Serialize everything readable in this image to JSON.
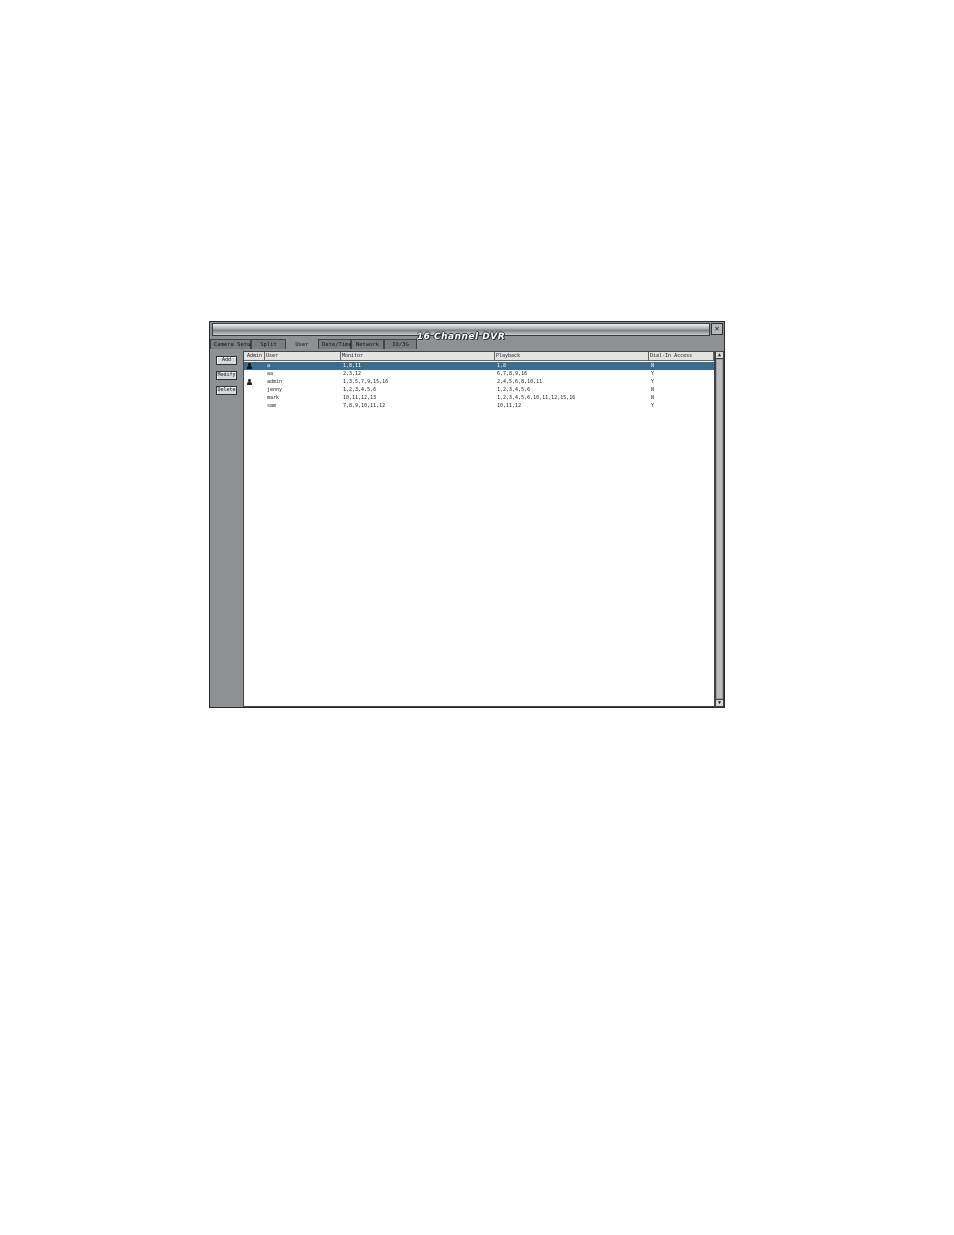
{
  "window": {
    "title": "16 Channel DVR",
    "close_icon": "close-icon"
  },
  "tabs": [
    {
      "label": "Camera Setup",
      "active": false
    },
    {
      "label": "Split",
      "active": false
    },
    {
      "label": "User",
      "active": true
    },
    {
      "label": "Date/Time",
      "active": false
    },
    {
      "label": "Network",
      "active": false
    },
    {
      "label": "IO/3G",
      "active": false
    }
  ],
  "actions": {
    "add_label": "Add",
    "modify_label": "Modify",
    "delete_label": "Delete"
  },
  "table": {
    "columns": [
      "Admin",
      "User",
      "Monitor",
      "Playback",
      "Dial-In Access"
    ],
    "rows": [
      {
        "admin": true,
        "user": "a",
        "monitor": "1,8,11",
        "playback": "1,8",
        "dial_in": "N",
        "selected": true
      },
      {
        "admin": false,
        "user": "aa",
        "monitor": "2,3,12",
        "playback": "6,7,8,9,16",
        "dial_in": "Y",
        "selected": false
      },
      {
        "admin": true,
        "user": "admin",
        "monitor": "1,3,5,7,9,15,16",
        "playback": "2,4,5,6,8,10,11",
        "dial_in": "Y",
        "selected": false
      },
      {
        "admin": false,
        "user": "jenny",
        "monitor": "1,2,3,4,5,6",
        "playback": "1,2,3,4,5,6",
        "dial_in": "N",
        "selected": false
      },
      {
        "admin": false,
        "user": "mark",
        "monitor": "10,11,12,13",
        "playback": "1,2,3,4,5,6,10,11,12,15,16",
        "dial_in": "N",
        "selected": false
      },
      {
        "admin": false,
        "user": "sam",
        "monitor": "7,8,9,10,11,12",
        "playback": "10,11,12",
        "dial_in": "Y",
        "selected": false
      }
    ]
  },
  "colors": {
    "selection": "#3b6e8e",
    "panel": "#8e9194"
  }
}
